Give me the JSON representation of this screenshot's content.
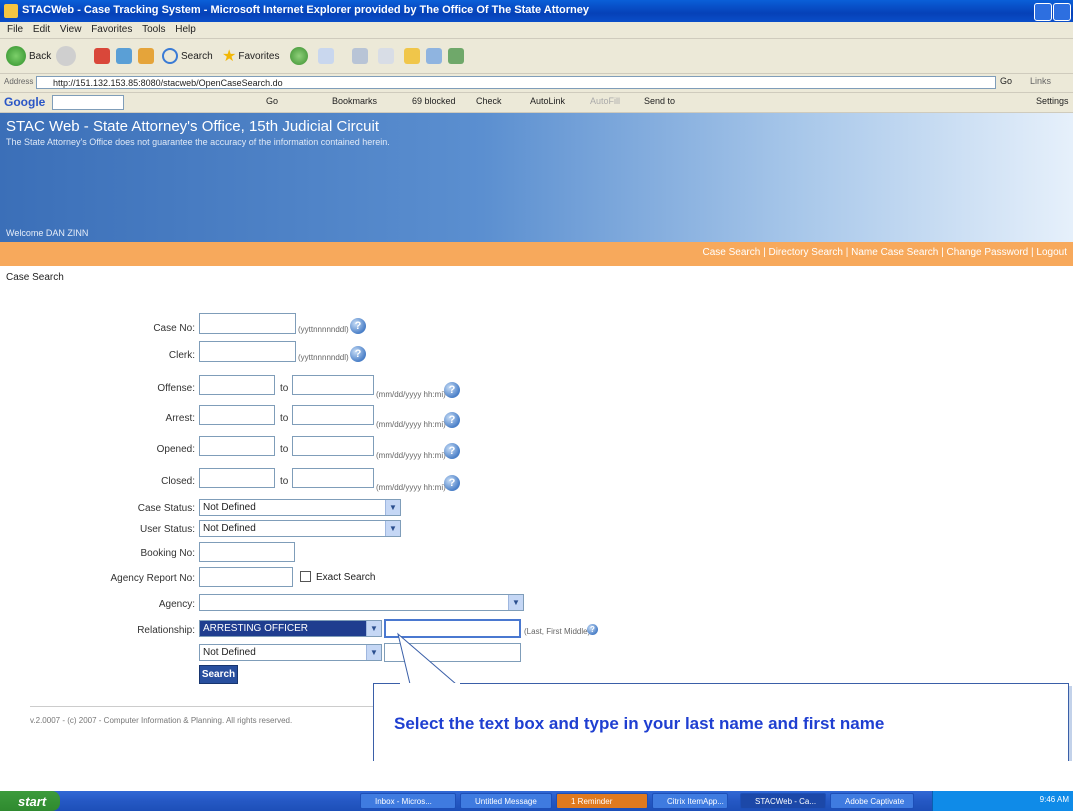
{
  "window": {
    "title": "STACWeb - Case Tracking System - Microsoft Internet Explorer provided by The Office Of The State Attorney"
  },
  "menu": [
    "File",
    "Edit",
    "View",
    "Favorites",
    "Tools",
    "Help"
  ],
  "toolbar": {
    "back": "Back",
    "search": "Search",
    "favorites": "Favorites"
  },
  "address": {
    "label": "Address",
    "url": "http://151.132.153.85:8080/stacweb/OpenCaseSearch.do",
    "go": "Go",
    "links": "Links"
  },
  "googlebar": {
    "brand": "Google",
    "items": [
      "Go",
      "Bookmarks",
      "69 blocked",
      "Check",
      "AutoLink",
      "AutoFill",
      "Send to"
    ],
    "settings": "Settings"
  },
  "banner": {
    "heading": "STAC Web - State Attorney's Office, 15th Judicial Circuit",
    "disclaimer": "The State Attorney's Office does not guarantee the accuracy of the information contained herein.",
    "welcome": "Welcome DAN ZINN"
  },
  "nav": {
    "links": [
      "Case Search",
      "Directory Search",
      "Name Case Search",
      "Change Password",
      "Logout"
    ],
    "separator": " | "
  },
  "breadcrumb": "Case Search",
  "form": {
    "case_no_label": "Case No:",
    "case_no_hint": "(yyttnnnnnddl)",
    "clerk_label": "Clerk:",
    "clerk_hint": "(yyttnnnnnddl)",
    "offense_label": "Offense:",
    "arrest_label": "Arrest:",
    "opened_label": "Opened:",
    "closed_label": "Closed:",
    "to": "to",
    "date_hint": "(mm/dd/yyyy hh:mi)",
    "case_status_label": "Case Status:",
    "case_status_value": "Not Defined",
    "user_status_label": "User Status:",
    "user_status_value": "Not Defined",
    "booking_label": "Booking No:",
    "agency_report_label": "Agency Report No:",
    "exact_search": "Exact Search",
    "agency_label": "Agency:",
    "relationship_label": "Relationship:",
    "relationship_value": "ARRESTING OFFICER",
    "name_hint": "(Last, First Middle)",
    "relationship2_value": "Not Defined",
    "search_button": "Search",
    "help_glyph": "?"
  },
  "footer": "v.2.0007 - (c) 2007 - Computer Information & Planning. All rights reserved.",
  "callout": "Select the text box and type in your last name and first name",
  "taskbar": {
    "start": "start",
    "tasks": [
      "Inbox - Micros...",
      "Untitled Message",
      "1 Reminder",
      "Citrix ItemApp...",
      "STACWeb - Ca...",
      "Adobe Captivate"
    ],
    "clock": "9:46 AM"
  }
}
